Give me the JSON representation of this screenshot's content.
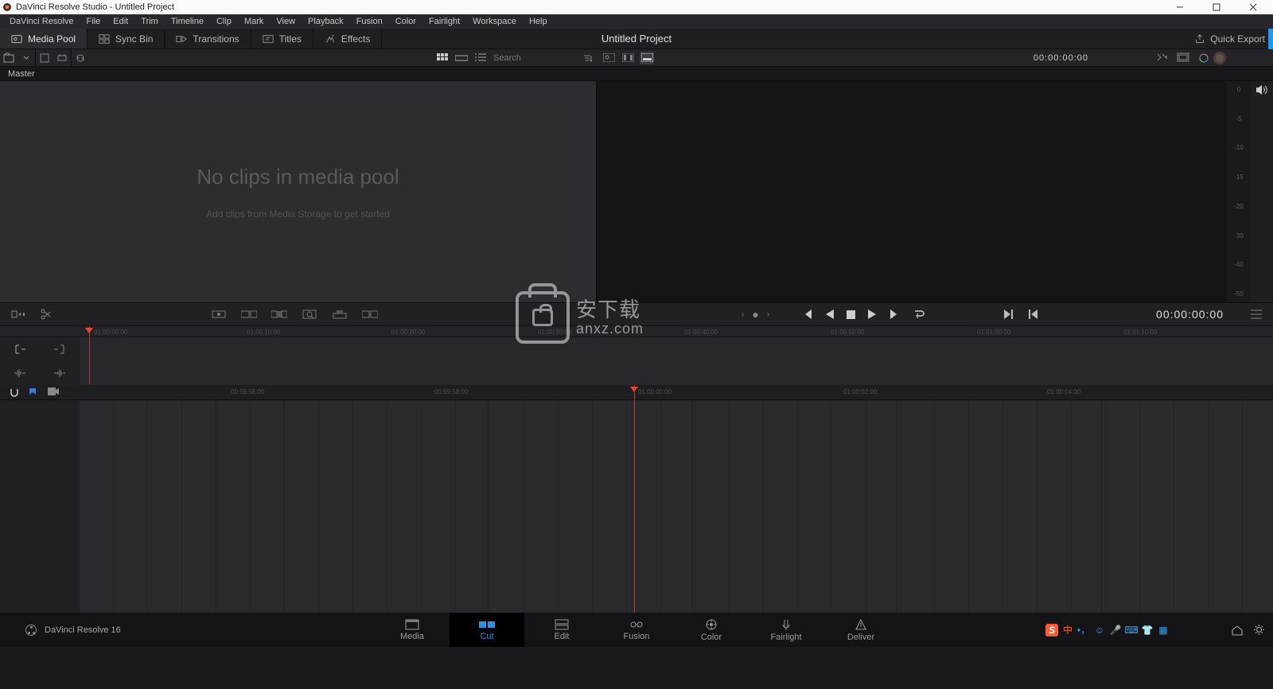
{
  "title": "DaVinci Resolve Studio - Untitled Project",
  "window_buttons": [
    "min",
    "max",
    "close"
  ],
  "menu": [
    "DaVinci Resolve",
    "File",
    "Edit",
    "Trim",
    "Timeline",
    "Clip",
    "Mark",
    "View",
    "Playback",
    "Fusion",
    "Color",
    "Fairlight",
    "Workspace",
    "Help"
  ],
  "tabs": {
    "media_pool": "Media Pool",
    "sync_bin": "Sync Bin",
    "transitions": "Transitions",
    "titles": "Titles",
    "effects": "Effects"
  },
  "project_title": "Untitled Project",
  "quick_export": "Quick Export",
  "search_placeholder": "Search",
  "timecode_top": "00:00:00:00",
  "bin_master": "Master",
  "empty_big": "No clips in media pool",
  "empty_small": "Add clips from Media Storage to get started",
  "vu_ticks": [
    "0",
    "-5",
    "-10",
    "-15",
    "-20",
    "-30",
    "-40",
    "-50"
  ],
  "timecode_transport": "00:00:00:00",
  "ruler_top": [
    "01:00:00:00",
    "01:00:10:00",
    "01:00:20:00",
    "01:00:30:00",
    "01:00:40:00",
    "01:00:50:00",
    "01:01:00:00",
    "01:01:10:00"
  ],
  "ruler_low": [
    "00:59:56:00",
    "00:59:58:00",
    "01:00:00:00",
    "01:00:02:00",
    "01:00:04:00"
  ],
  "bottom_brand": "DaVinci Resolve 16",
  "pages": [
    {
      "k": "media",
      "label": "Media"
    },
    {
      "k": "cut",
      "label": "Cut"
    },
    {
      "k": "edit",
      "label": "Edit"
    },
    {
      "k": "fusion",
      "label": "Fusion"
    },
    {
      "k": "color",
      "label": "Color"
    },
    {
      "k": "fairlight",
      "label": "Fairlight"
    },
    {
      "k": "deliver",
      "label": "Deliver"
    }
  ],
  "ime": {
    "s": "S",
    "zh": "中"
  },
  "watermark": {
    "cn": "安下载",
    "en": "anxz.com"
  }
}
